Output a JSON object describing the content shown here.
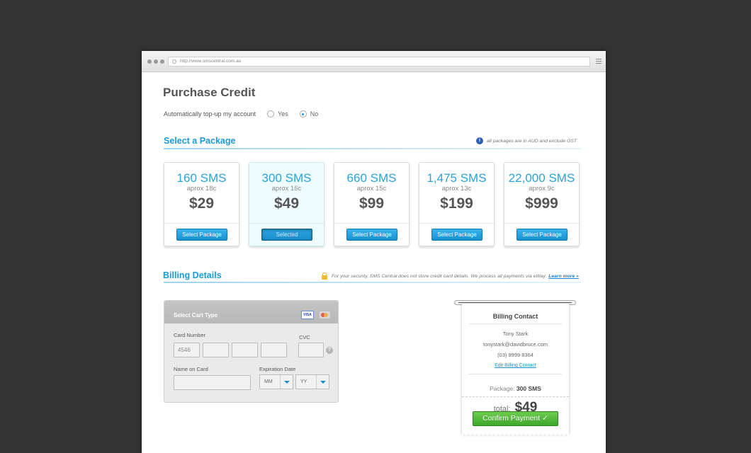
{
  "browser": {
    "url": "http://www.smscentral.com.au"
  },
  "page": {
    "title": "Purchase Credit"
  },
  "autotopup": {
    "label": "Automatically top-up my account",
    "options": [
      "Yes",
      "No"
    ],
    "selected": "No"
  },
  "package_section": {
    "title": "Select a Package",
    "note": "all packages are in AUD and exclude GST"
  },
  "packages": [
    {
      "sms": "160 SMS",
      "aprox": "aprox 18c",
      "price": "$29",
      "button": "Select Package",
      "selected": false
    },
    {
      "sms": "300 SMS",
      "aprox": "aprox 16c",
      "price": "$49",
      "button": "Selected",
      "selected": true
    },
    {
      "sms": "660 SMS",
      "aprox": "aprox 15c",
      "price": "$99",
      "button": "Select Package",
      "selected": false
    },
    {
      "sms": "1,475 SMS",
      "aprox": "aprox 13c",
      "price": "$199",
      "button": "Select Package",
      "selected": false
    },
    {
      "sms": "22,000 SMS",
      "aprox": "aprox 9c",
      "price": "$999",
      "button": "Select Package",
      "selected": false
    }
  ],
  "billing_section": {
    "title": "Billing Details",
    "note": "For your security, SMS Central does not store credit card details. We process all payments via eWay.",
    "learn_more": "Learn more »"
  },
  "card_form": {
    "header": "Select Cart Type",
    "card_types": [
      "VISA",
      "MasterCard"
    ],
    "card_number_label": "Card Number",
    "card_number_values": [
      "4546",
      "",
      "",
      ""
    ],
    "cvc_label": "CVC",
    "cvc_help": "?",
    "name_label": "Name on Card",
    "name_value": "",
    "expiry_label": "Expiration Date",
    "month": "MM",
    "year": "YY"
  },
  "billing_contact": {
    "title": "Billing Contact",
    "name": "Tony Stark",
    "email": "tonystark@davidbruce.com",
    "phone": "(03) 9999 8364",
    "edit_link": "Edit Billing Contact",
    "package_label": "Package:",
    "package_value": "300 SMS",
    "total_label": "total:",
    "total_value": "$49",
    "confirm_button": "Confirm Payment ✓"
  },
  "colors": {
    "accent": "#1a9ad6",
    "confirm": "#4cb535",
    "background": "#333333"
  }
}
